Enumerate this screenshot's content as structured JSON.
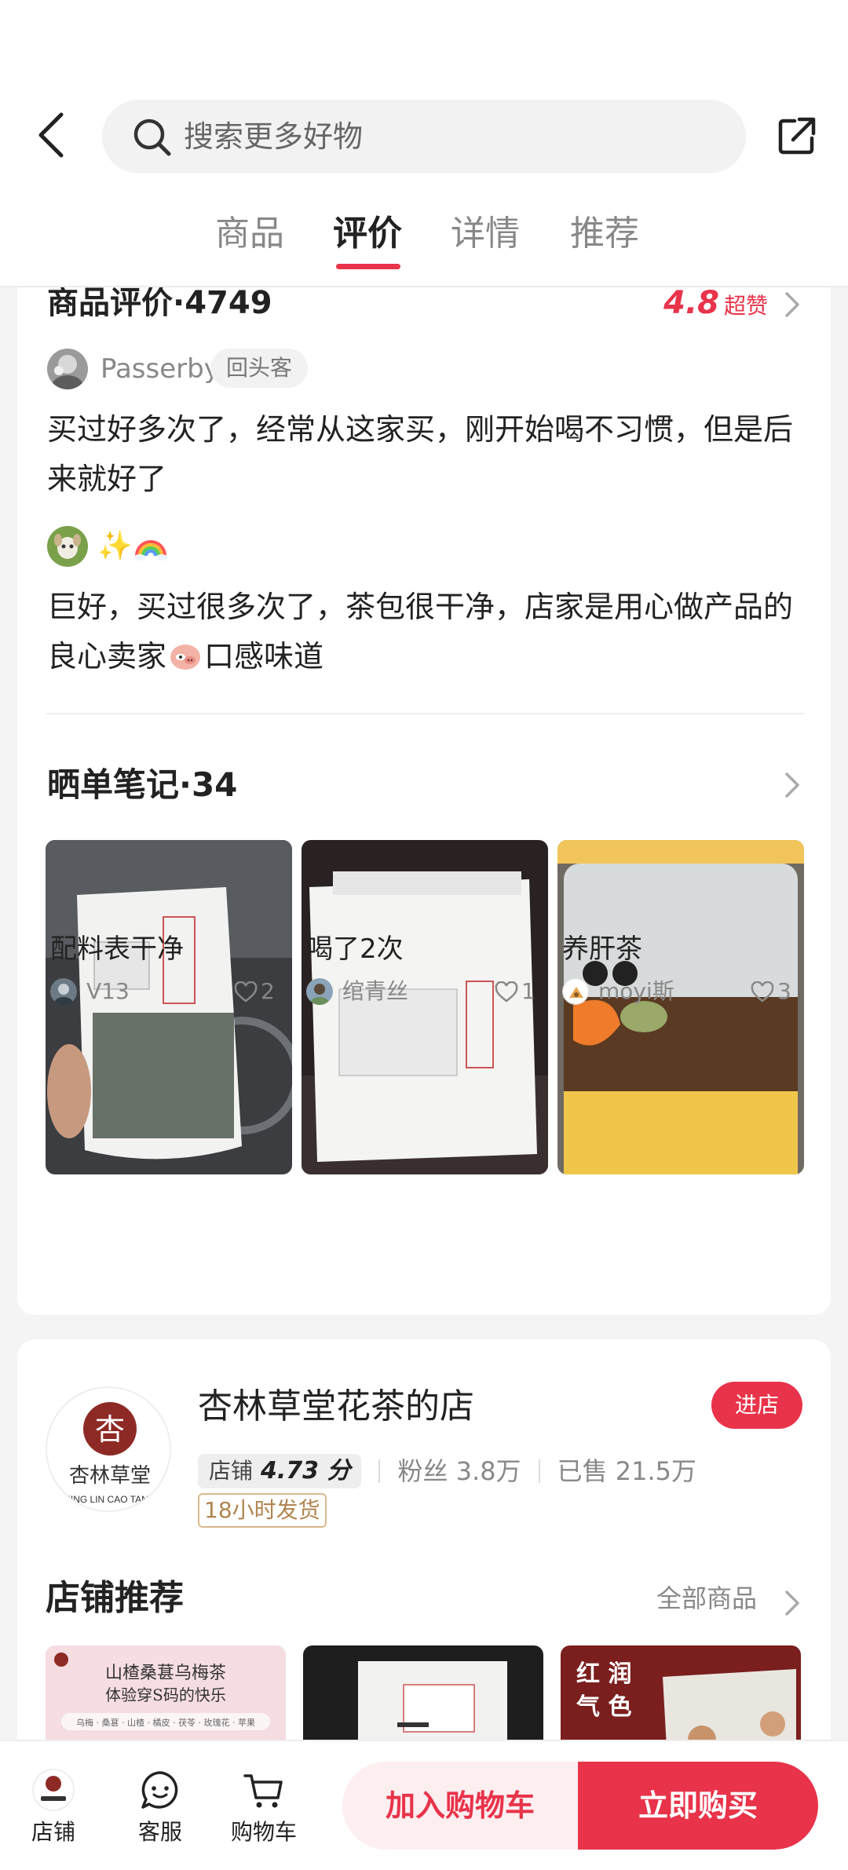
{
  "header": {
    "search_placeholder": "搜索更多好物",
    "tabs": [
      {
        "label": "商品",
        "active": false
      },
      {
        "label": "评价",
        "active": true
      },
      {
        "label": "详情",
        "active": false
      },
      {
        "label": "推荐",
        "active": false
      }
    ]
  },
  "reviews": {
    "title": "商品评价·4749",
    "rating": "4.8",
    "rating_tag": "超赞",
    "items": [
      {
        "name": "Passerby",
        "badge": "回头客",
        "text": "买过好多次了，经常从这家买，刚开始喝不习惯，但是后来就好了"
      },
      {
        "name": "✨",
        "text_before": "巨好，买过很多次了，茶包很干净，店家是用心做产品的良心卖家",
        "text_after": "口感味道"
      }
    ]
  },
  "notes": {
    "title": "晒单笔记·34",
    "items": [
      {
        "caption": "配料表干净",
        "user": "V13",
        "likes": "2"
      },
      {
        "caption": "喝了2次",
        "user": "绾青丝",
        "likes": "1"
      },
      {
        "caption": "养肝茶",
        "user": "moyi斯",
        "likes": "3"
      }
    ]
  },
  "shop": {
    "logo_text": "杏林草堂",
    "logo_subtext": "XING LIN CAO TANG",
    "name": "杏林草堂花茶的店",
    "enter_label": "进店",
    "score_label": "店铺",
    "score": "4.73 分",
    "fans": "粉丝 3.8万",
    "sold": "已售 21.5万",
    "ship_tag": "18小时发货",
    "recs_title": "店铺推荐",
    "recs_all": "全部商品",
    "rec_items": [
      {
        "line1": "山楂桑葚乌梅茶",
        "line2": "体验穿S码的快乐",
        "line3": "乌梅 · 桑葚 · 山楂 · 橘皮 · 茯苓 · 玫瑰花 · 苹果"
      },
      {
        "line1": "",
        "line2": "",
        "line3": ""
      },
      {
        "line1": "红 润",
        "line2": "气 色",
        "line3": ""
      }
    ]
  },
  "bottom_bar": {
    "shop_label": "店铺",
    "service_label": "客服",
    "cart_label": "购物车",
    "add_cart": "加入购物车",
    "buy_now": "立即购买"
  },
  "colors": {
    "accent": "#e8334a",
    "accent_light": "#fdeef0",
    "ship_tag": "#b08550"
  }
}
